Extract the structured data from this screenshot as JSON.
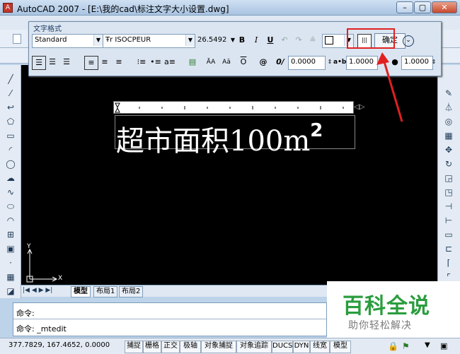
{
  "window": {
    "title": "AutoCAD 2007 - [E:\\我的cad\\标注文字大小设置.dwg]",
    "minimize_label": "–",
    "restore_label": "▢",
    "close_label": "✕"
  },
  "text_format": {
    "title": "文字格式",
    "style": "Standard",
    "font_prefix": "Ŧr",
    "font": "ISOCPEUR",
    "height": "26.5492",
    "bold_label": "B",
    "italic_label": "I",
    "underline_label": "U",
    "ruler_icon_label": "|||",
    "ok_label": "确定",
    "oblique_value": "0.0000",
    "tracking_value": "1.0000",
    "width_value": "1.0000",
    "at_label": "@"
  },
  "mtext": {
    "content": "超市面积100m",
    "superscript": "2"
  },
  "tabs": [
    "模型",
    "布局1",
    "布局2"
  ],
  "ucs": {
    "y": "Y",
    "x": "X"
  },
  "command": {
    "line1_label": "命令:",
    "line2_label": "命令:",
    "line2_value": "_mtedit"
  },
  "status": {
    "coords": "377.7829, 167.4652, 0.0000",
    "buttons": [
      "捕捉",
      "栅格",
      "正交",
      "极轴",
      "对象捕捉",
      "对象追踪",
      "DUCS",
      "DYN",
      "线宽",
      "模型"
    ]
  },
  "watermark": {
    "title": "百科全说",
    "subtitle": "助你轻松解决"
  },
  "colors": {
    "highlight": "#e02020",
    "canvas": "#000000",
    "watermark": "#2a9d3e"
  }
}
